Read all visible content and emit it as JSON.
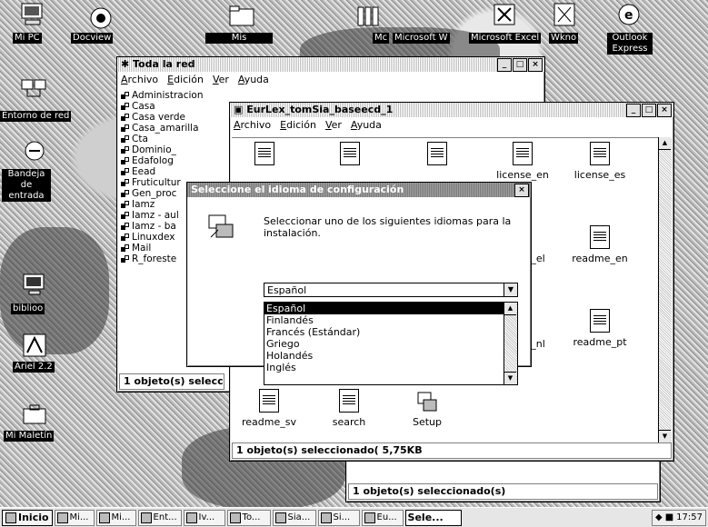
{
  "desktop_icons": [
    {
      "name": "mi-pc",
      "label": "Mi PC"
    },
    {
      "name": "docview",
      "label": "Docview"
    },
    {
      "name": "mis",
      "label": "Mis"
    },
    {
      "name": "mc",
      "label": "Mc"
    },
    {
      "name": "microsoft-w",
      "label": "Microsoft W"
    },
    {
      "name": "microsoft-excel",
      "label": "Microsoft Excel"
    },
    {
      "name": "wkno",
      "label": "Wkno"
    },
    {
      "name": "outlook-express",
      "label": "Outlook Express"
    },
    {
      "name": "entorno-de-red",
      "label": "Entorno de red"
    },
    {
      "name": "bandeja-de-entrada",
      "label": "Bandeja de entrada"
    },
    {
      "name": "biblioo",
      "label": "biblioo"
    },
    {
      "name": "ariel",
      "label": "Ariel 2.2"
    },
    {
      "name": "mi-maletin",
      "label": "Mi Maletín"
    }
  ],
  "toda_red": {
    "title": "Toda la red",
    "menu": [
      "Archivo",
      "Edición",
      "Ver",
      "Ayuda"
    ],
    "items": [
      "Administracion",
      "Casa",
      "Casa verde",
      "Casa_amarilla",
      "Cta",
      "Dominio_",
      "Edafolog",
      "Eead",
      "Fruticultur",
      "Gen_proc",
      "Iamz",
      "Iamz - aul",
      "Iamz - ba",
      "Linuxdex",
      "Mail",
      "R_foreste"
    ],
    "status": "1 objeto(s) selecc"
  },
  "eurlex": {
    "title": "EurLex_tomSia_baseecd_1",
    "menu": [
      "Archivo",
      "Edición",
      "Ver",
      "Ayuda"
    ],
    "top_labels": [
      "license_en",
      "license_es"
    ],
    "right_files": [
      "readme_en",
      "readme_pt"
    ],
    "partial_labels": [
      "_el",
      "_nl"
    ],
    "bottom_files": [
      "readme_sv",
      "search",
      "Setup"
    ],
    "status": "1 objeto(s) seleccionado( 5,75KB"
  },
  "dialog": {
    "title": "Seleccione el idioma de configuración",
    "message": "Seleccionar uno de los siguientes idiomas para la instalación.",
    "combo_value": "Español",
    "options": [
      "Español",
      "Finlandés",
      "Francés (Estándar)",
      "Griego",
      "Holandés",
      "Inglés"
    ],
    "selected_index": 0
  },
  "bg_status": "1 objeto(s) seleccionado(s)",
  "taskbar": {
    "start": "Inicio",
    "buttons": [
      "Mi...",
      "Mi...",
      "Ent...",
      "Iv...",
      "To...",
      "Sia...",
      "Si...",
      "Eu...",
      "Sele..."
    ],
    "active_index": 8,
    "clock": "17:57"
  }
}
